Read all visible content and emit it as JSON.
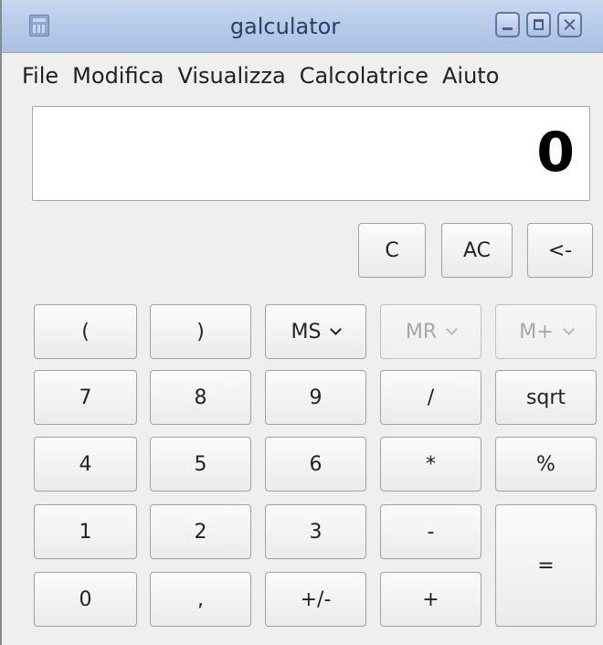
{
  "window": {
    "title": "galculator"
  },
  "menu": [
    "File",
    "Modifica",
    "Visualizza",
    "Calcolatrice",
    "Aiuto"
  ],
  "display": {
    "value": "0"
  },
  "buttons": {
    "clear": "C",
    "all_clear": "AC",
    "backspace": "<-",
    "paren_open": "(",
    "paren_close": ")",
    "memory_store": "MS",
    "memory_recall": "MR",
    "memory_add": "M+",
    "d7": "7",
    "d8": "8",
    "d9": "9",
    "divide": "/",
    "sqrt": "sqrt",
    "d4": "4",
    "d5": "5",
    "d6": "6",
    "multiply": "*",
    "percent": "%",
    "d1": "1",
    "d2": "2",
    "d3": "3",
    "minus": "-",
    "equals": "=",
    "d0": "0",
    "decimal": ",",
    "sign": "+/-",
    "plus": "+"
  },
  "colors": {
    "titlebar": "#b8cbe9",
    "title_text": "#2c3e66",
    "window_bg": "#efefed",
    "disabled_text": "#a8a8a8"
  },
  "icons": [
    "calculator-app-icon",
    "minimize-icon",
    "maximize-icon",
    "close-icon",
    "chevron-down-icon"
  ]
}
